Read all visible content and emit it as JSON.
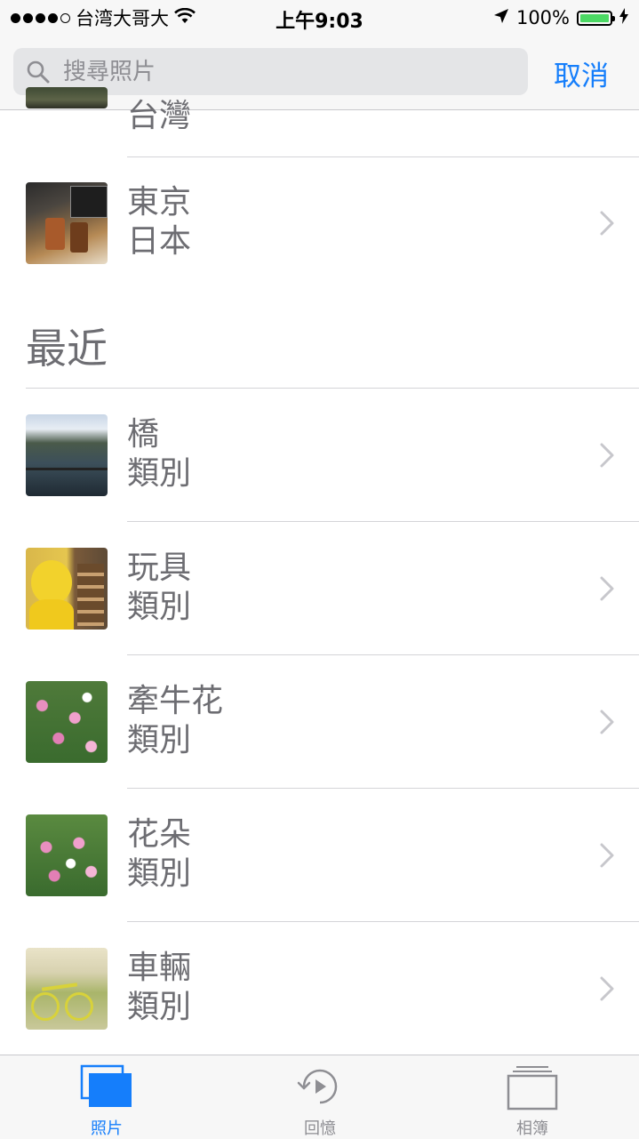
{
  "status_bar": {
    "carrier": "台湾大哥大",
    "time": "上午9:03",
    "battery": "100%",
    "icons": [
      "signal-dots-icon",
      "wifi-icon",
      "location-arrow-icon",
      "battery-icon",
      "charging-bolt-icon"
    ]
  },
  "search": {
    "placeholder": "搜尋照片",
    "cancel_label": "取消"
  },
  "partial_row": {
    "title": "台灣"
  },
  "places": [
    {
      "title": "東京",
      "subtitle": "日本"
    }
  ],
  "recent": {
    "header": "最近",
    "items": [
      {
        "title": "橋",
        "subtitle": "類別"
      },
      {
        "title": "玩具",
        "subtitle": "類別"
      },
      {
        "title": "牽牛花",
        "subtitle": "類別"
      },
      {
        "title": "花朵",
        "subtitle": "類別"
      },
      {
        "title": "車輛",
        "subtitle": "類別"
      }
    ]
  },
  "tab_bar": {
    "tabs": [
      {
        "label": "照片",
        "icon": "photos-icon",
        "active": true
      },
      {
        "label": "回憶",
        "icon": "memories-icon",
        "active": false
      },
      {
        "label": "相簿",
        "icon": "albums-icon",
        "active": false
      }
    ]
  },
  "colors": {
    "accent": "#157efb",
    "battery": "#4cd964",
    "text_secondary": "#6d6d72"
  }
}
